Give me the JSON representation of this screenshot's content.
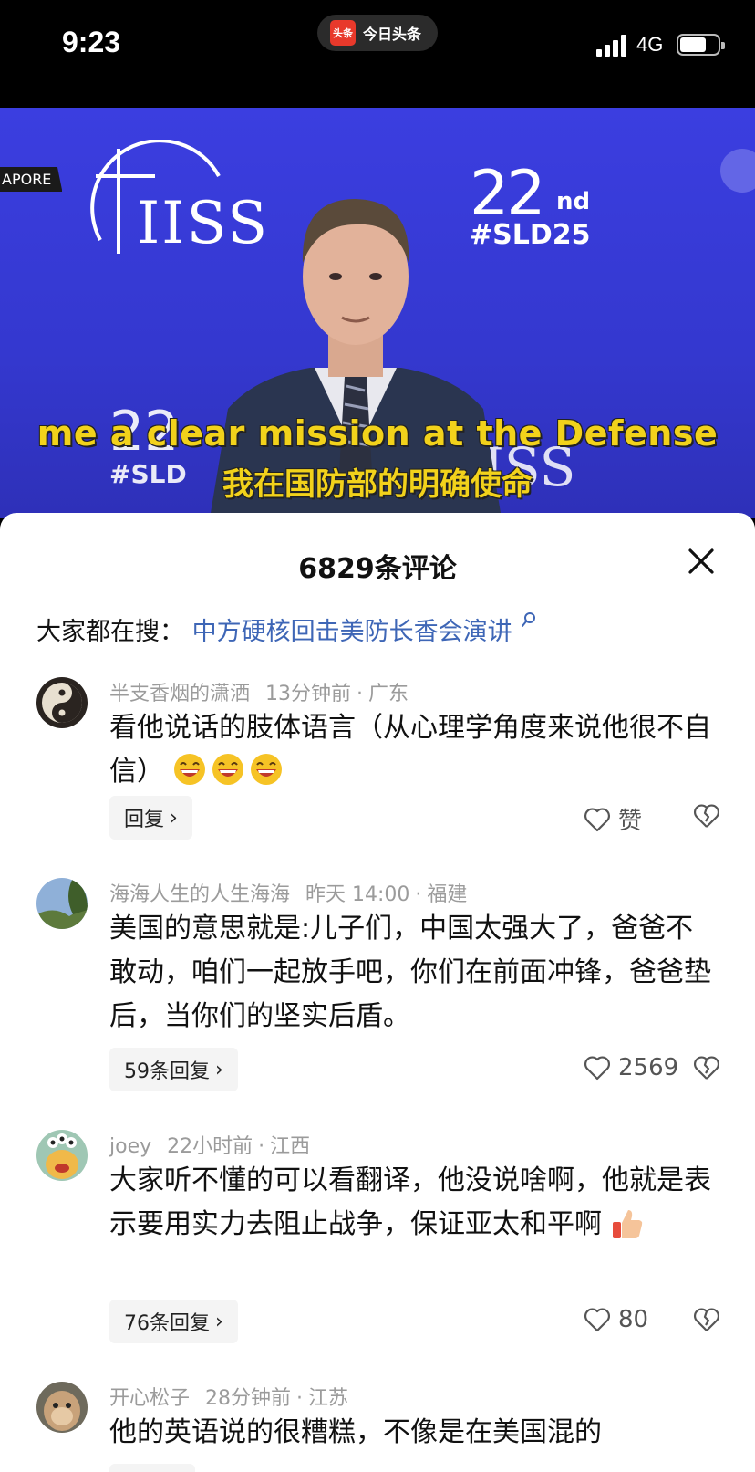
{
  "status_bar": {
    "time": "9:23",
    "app_logo_text": "头条",
    "app_name": "今日头条",
    "network": "4G"
  },
  "video": {
    "live_tag": "APORE",
    "logo_text": "IISS",
    "event_number": "22",
    "event_suffix": "nd",
    "event_tag": "#SLD25",
    "background_number": "22",
    "background_tag": "#SLD",
    "background_logo": "ISS",
    "caption_en": "me a clear mission at the Defense",
    "caption_zh": "我在国防部的明确使命"
  },
  "sheet": {
    "title": "6829条评论",
    "search_prefix": "大家都在搜：",
    "search_link": "中方硬核回击美防长香会演讲"
  },
  "comments": [
    {
      "user": "半支香烟的潇洒",
      "time": "13分钟前",
      "location": "广东",
      "text": "看他说话的肢体语言（从心理学角度来说他很不自信）",
      "reply_label": "回复",
      "like_label": "赞"
    },
    {
      "user": "海海人生的人生海海",
      "time": "昨天 14:00",
      "location": "福建",
      "text": "美国的意思就是:儿子们，中国太强大了，爸爸不敢动，咱们一起放手吧，你们在前面冲锋，爸爸垫后，当你们的坚实后盾。",
      "reply_label": "59条回复",
      "like_label": "2569"
    },
    {
      "user": "joey",
      "time": "22小时前",
      "location": "江西",
      "text": "大家听不懂的可以看翻译，他没说啥啊，他就是表示要用实力去阻止战争，保证亚太和平啊",
      "reply_label": "76条回复",
      "like_label": "80"
    },
    {
      "user": "开心松子",
      "time": "28分钟前",
      "location": "江苏",
      "text": "他的英语说的很糟糕，不像是在美国混的"
    }
  ],
  "colors": {
    "video_background": "#3b3ee0",
    "caption": "#f2d21b",
    "search_link": "#3e66b6",
    "meta_text": "#9b9b9b"
  }
}
